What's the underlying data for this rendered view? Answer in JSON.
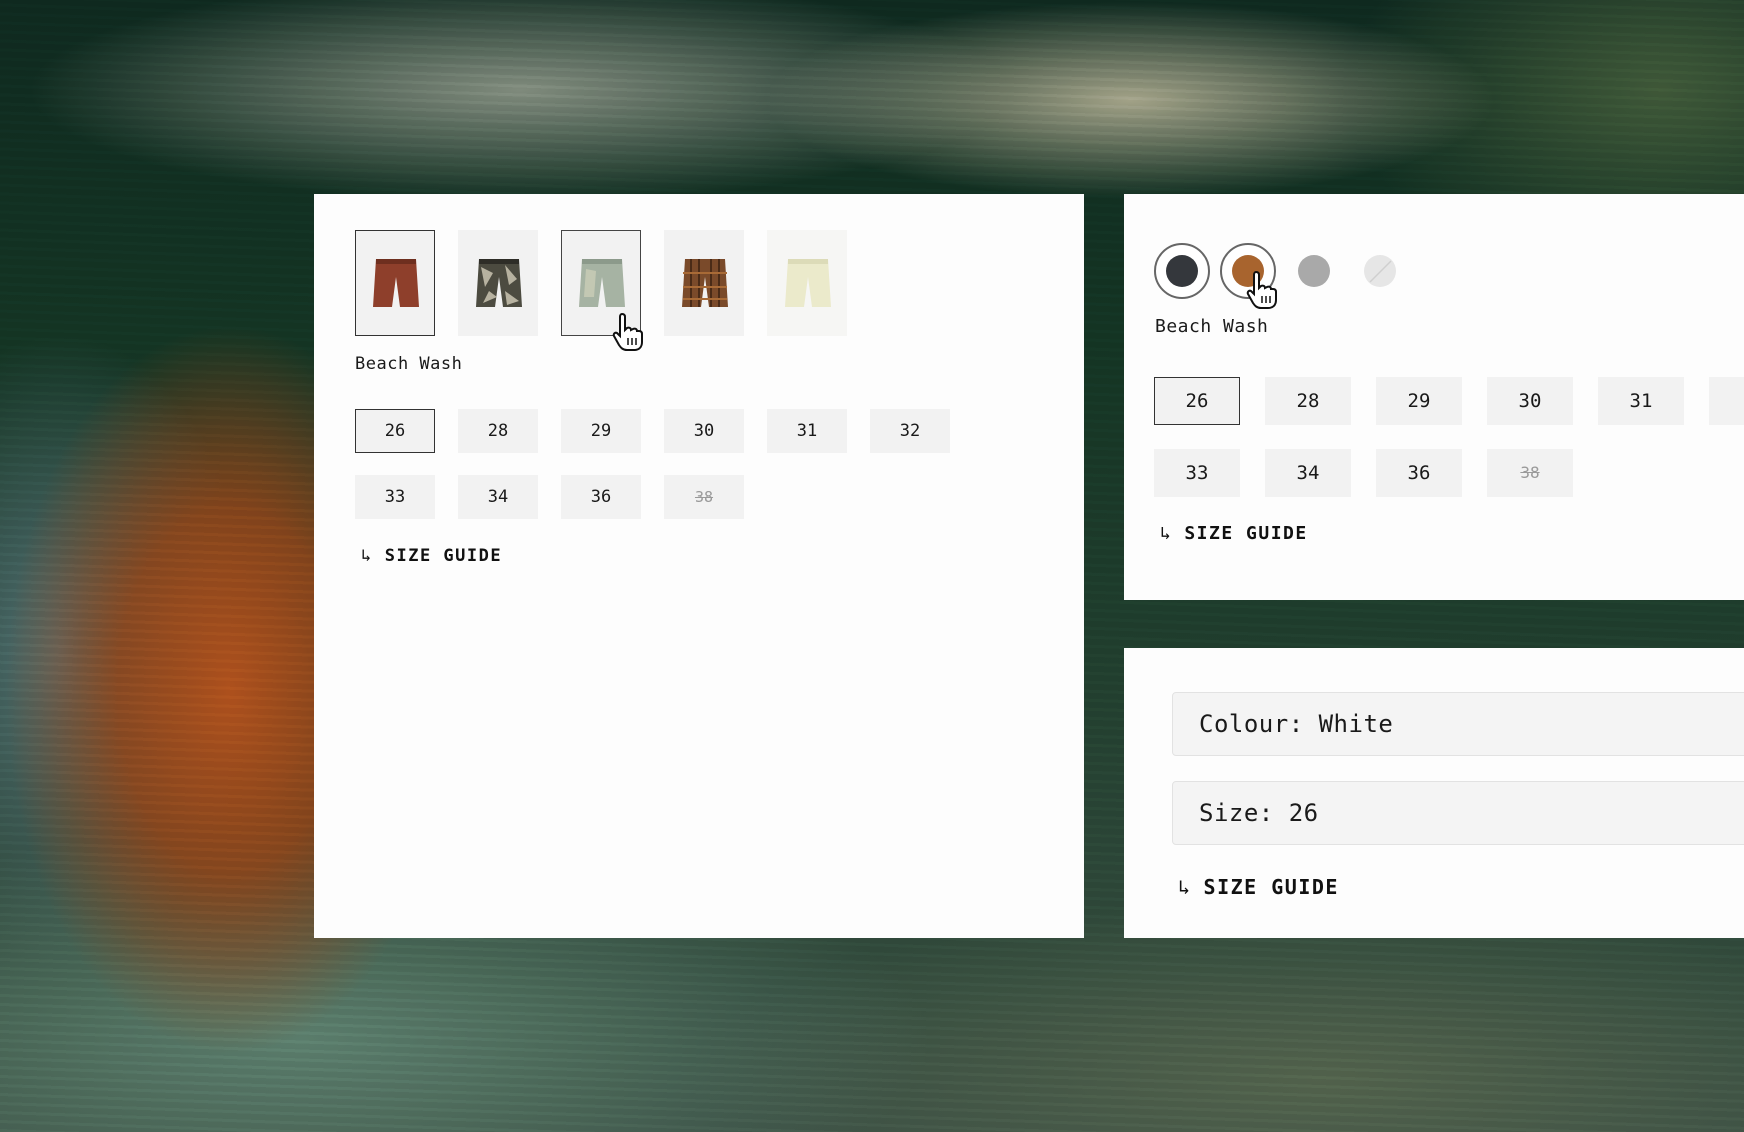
{
  "panel_a": {
    "thumbnails": [
      {
        "name": "rust-shorts",
        "color": "#8e3f2b",
        "selected": true
      },
      {
        "name": "camo-print-shorts",
        "color": "#5b5a4d",
        "selected": false
      },
      {
        "name": "light-wash-denim-shorts",
        "color": "#9fae9e",
        "selected": false,
        "hovered": true
      },
      {
        "name": "brown-plaid-shorts",
        "color": "#7a4a2a",
        "selected": false
      },
      {
        "name": "cream-shorts",
        "color": "#e8e7c6",
        "selected": false
      }
    ],
    "color_name": "Beach Wash",
    "sizes_row1": [
      "26",
      "28",
      "29",
      "30",
      "31",
      "32"
    ],
    "sizes_row2": [
      "33",
      "34",
      "36",
      "38"
    ],
    "selected_size": "26",
    "disabled_size": "38",
    "size_guide": "SIZE GUIDE",
    "arrow": "↳"
  },
  "panel_b": {
    "swatches": [
      {
        "name": "charcoal",
        "color": "#34373c",
        "selected": true
      },
      {
        "name": "brown",
        "color": "#a8642e",
        "selected": true,
        "hovered": true
      },
      {
        "name": "grey",
        "color": "#a9a9a9",
        "selected": false
      },
      {
        "name": "unavailable",
        "color": "#e6e6e6",
        "disabled": true
      }
    ],
    "color_name": "Beach Wash",
    "sizes_row1": [
      "26",
      "28",
      "29",
      "30",
      "31"
    ],
    "sizes_row2": [
      "33",
      "34",
      "36",
      "38"
    ],
    "selected_size": "26",
    "disabled_size": "38",
    "size_guide": "SIZE GUIDE",
    "arrow": "↳"
  },
  "panel_c": {
    "colour_select": "Colour: White",
    "size_select": "Size: 26",
    "size_guide": "SIZE GUIDE",
    "arrow": "↳"
  }
}
